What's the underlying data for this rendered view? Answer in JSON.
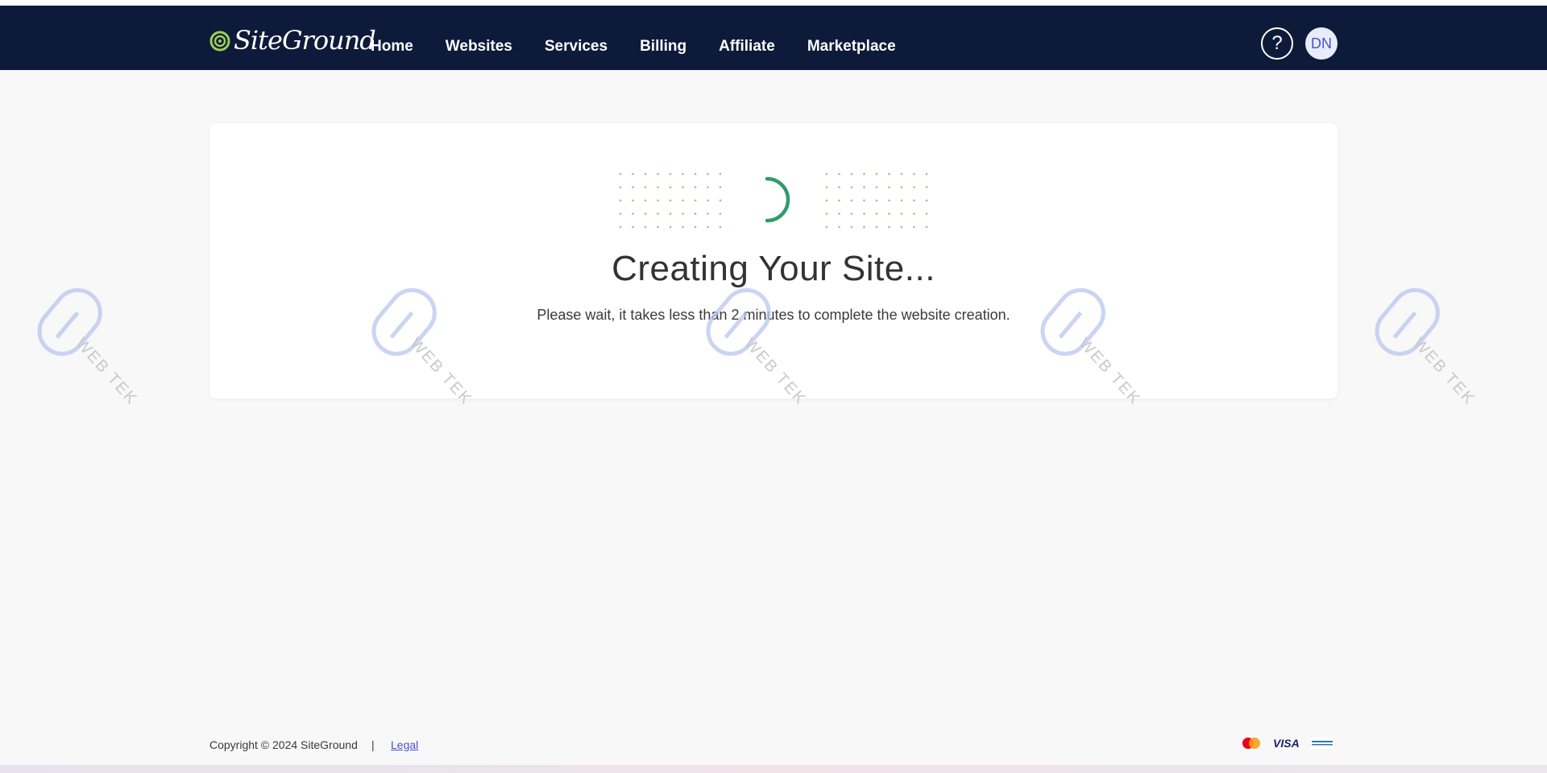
{
  "header": {
    "logo_text": "SiteGround",
    "nav": [
      "Home",
      "Websites",
      "Services",
      "Billing",
      "Affiliate",
      "Marketplace"
    ],
    "help_label": "?",
    "avatar_initials": "DN"
  },
  "main": {
    "title": "Creating Your Site...",
    "subtitle": "Please wait, it takes less than 2 minutes to complete the website creation."
  },
  "watermark": {
    "text": "WEB TEK"
  },
  "footer": {
    "copyright": "Copyright © 2024 SiteGround",
    "separator": "|",
    "legal": "Legal",
    "payments": [
      "mastercard",
      "VISA",
      "american-express"
    ]
  },
  "colors": {
    "header_bg": "#0e1a3a",
    "spinner": "#2e9c6a",
    "dots": "#c9b98f",
    "link": "#4a53c7"
  }
}
